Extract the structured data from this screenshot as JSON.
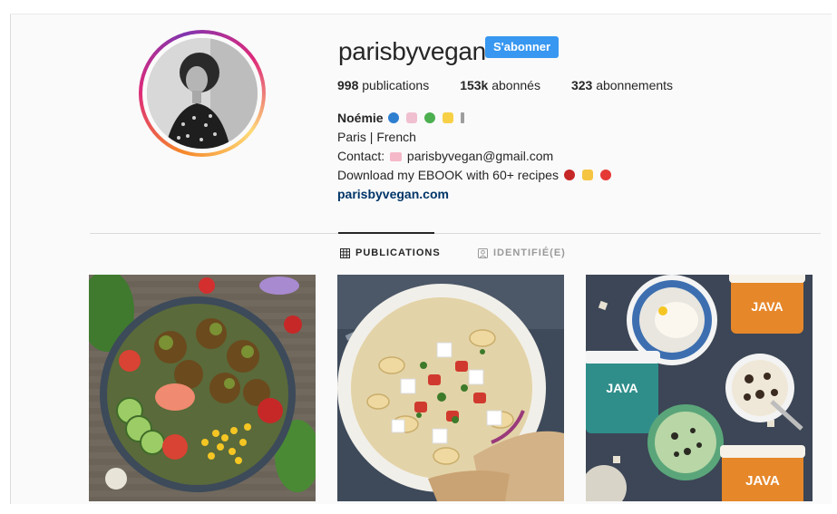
{
  "profile": {
    "username": "parisbyvegan",
    "follow_label": "S'abonner",
    "stats": {
      "posts_count": "998",
      "posts_label": "publications",
      "followers_count": "153k",
      "followers_label": "abonnés",
      "following_count": "323",
      "following_label": "abonnements"
    },
    "bio": {
      "name": "Noémie",
      "line1": "Paris | French",
      "contact_prefix": "Contact:",
      "contact_email": "parisbyvegan@gmail.com",
      "ebook": "Download my EBOOK with 60+ recipes",
      "website": "parisbyvegan.com"
    }
  },
  "tabs": [
    {
      "label": "PUBLICATIONS",
      "icon": "grid-icon",
      "active": true
    },
    {
      "label": "IDENTIFIÉ(E)",
      "icon": "tagged-icon",
      "active": false
    }
  ],
  "posts": [
    {
      "alt_icon": "falafel-bowl-photo"
    },
    {
      "alt_icon": "pasta-salad-photo"
    },
    {
      "alt_icon": "java-icecream-photo"
    }
  ],
  "colors": {
    "follow_button": "#3897f0",
    "link": "#003569",
    "background": "#fafafa"
  }
}
